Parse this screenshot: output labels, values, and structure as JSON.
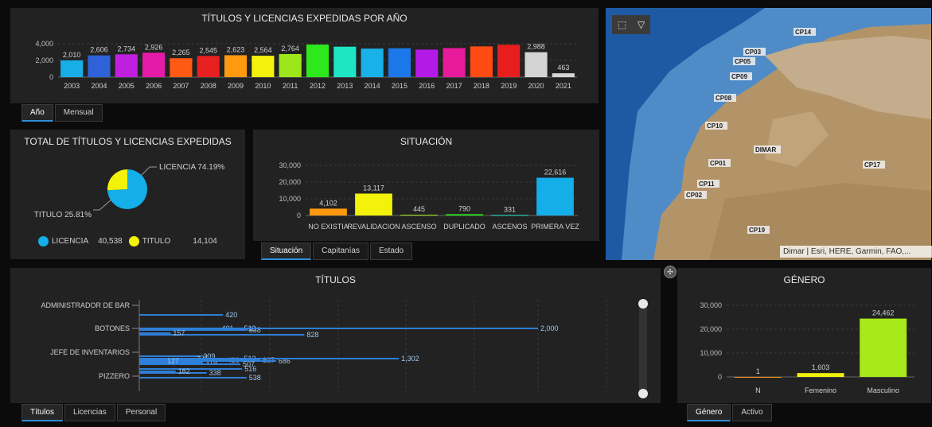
{
  "panels": {
    "years_title": "TÍTULOS Y LICENCIAS EXPEDIDAS POR AÑO",
    "total_title": "TOTAL DE TÍTULOS Y LICENCIAS EXPEDIDAS",
    "situacion_title": "SITUACIÓN",
    "titulos_title": "TÍTULOS",
    "genero_title": "GÉNERO"
  },
  "tabs": {
    "years": [
      "Año",
      "Mensual"
    ],
    "situacion": [
      "Situación",
      "Capitanías",
      "Estado"
    ],
    "titulos": [
      "Títulos",
      "Licencias",
      "Personal"
    ],
    "genero": [
      "Género",
      "Activo"
    ]
  },
  "legend": {
    "licencia_label": "LICENCIA",
    "licencia_value": "40,538",
    "licencia_color": "#14aee8",
    "titulo_label": "TITULO",
    "titulo_value": "14,104",
    "titulo_color": "#f2f20a"
  },
  "map": {
    "attribution": "Dimar | Esri, HERE, Garmin, FAO,...",
    "labels": [
      "CP14",
      "CP03",
      "CP05",
      "CP09",
      "CP08",
      "CP10",
      "DIMAR",
      "CP01",
      "CP17",
      "CP11",
      "CP02",
      "CP19"
    ]
  },
  "chart_data": [
    {
      "type": "bar",
      "title": "TÍTULOS Y LICENCIAS EXPEDIDAS POR AÑO",
      "categories": [
        "2003",
        "2004",
        "2005",
        "2006",
        "2007",
        "2008",
        "2009",
        "2010",
        "2011",
        "2012",
        "2013",
        "2014",
        "2015",
        "2016",
        "2017",
        "2018",
        "2019",
        "2020",
        "2021"
      ],
      "values": [
        2010,
        2606,
        2734,
        2926,
        2265,
        2545,
        2623,
        2564,
        2764,
        3900,
        3650,
        3420,
        3460,
        3300,
        3480,
        3680,
        3880,
        2988,
        463
      ],
      "data_labels": [
        "2,010",
        "2,606",
        "2,734",
        "2,926",
        "2,265",
        "2,545",
        "2,623",
        "2,564",
        "2,764",
        "",
        "",
        "",
        "",
        "",
        "",
        "",
        "",
        "2,988",
        "463"
      ],
      "colors": [
        "#17aee6",
        "#2f62d9",
        "#c01fe0",
        "#e61aa8",
        "#ff5a14",
        "#e8201f",
        "#ff9a10",
        "#f2f20c",
        "#9ce61a",
        "#2de81a",
        "#1ce6c4",
        "#18b2e8",
        "#1a78e8",
        "#b41ae6",
        "#e81a9c",
        "#ff4a14",
        "#e81e1e",
        "#d4d4d4",
        "#d4d4d4"
      ],
      "ylim": [
        0,
        4000
      ],
      "yticks": [
        "0",
        "2,000",
        "4,000"
      ]
    },
    {
      "type": "pie",
      "title": "TOTAL DE TÍTULOS Y LICENCIAS EXPEDIDAS",
      "labels": [
        "LICENCIA",
        "TITULO"
      ],
      "values": [
        40538,
        14104
      ],
      "percent_labels": [
        "LICENCIA 74.19%",
        "TITULO 25.81%"
      ],
      "colors": [
        "#14aee8",
        "#f2f20a"
      ]
    },
    {
      "type": "bar",
      "title": "SITUACIÓN",
      "categories": [
        "NO EXISTIA",
        "REVALIDACION",
        "ASCENSO",
        "DUPLICADO",
        "ASCENOS",
        "PRIMERA VEZ"
      ],
      "values": [
        4102,
        13117,
        445,
        790,
        331,
        22616
      ],
      "data_labels": [
        "4,102",
        "13,117",
        "445",
        "790",
        "331",
        "22,616"
      ],
      "colors": [
        "#ff9a10",
        "#f2f20a",
        "#a6e81a",
        "#2de81a",
        "#1ce6c4",
        "#14aee8"
      ],
      "ylim": [
        0,
        30000
      ],
      "yticks": [
        "0",
        "10,000",
        "20,000",
        "30,000"
      ]
    },
    {
      "type": "bar",
      "title": "TÍTULOS",
      "orientation": "horizontal",
      "categories": [
        "ADMINISTRADOR DE BAR",
        "BOTONES",
        "JEFE DE INVENTARIOS",
        "PIZZERO"
      ],
      "visible_values": [
        420,
        401,
        513,
        538,
        828,
        157,
        2000,
        309,
        275,
        319,
        430,
        513,
        607,
        686,
        507,
        516,
        1302,
        127,
        338,
        182,
        538
      ],
      "color": "#2e7fd9"
    },
    {
      "type": "bar",
      "title": "GÉNERO",
      "categories": [
        "N",
        "Femenino",
        "Masculino"
      ],
      "values": [
        1,
        1603,
        24462
      ],
      "data_labels": [
        "1",
        "1,603",
        "24,462"
      ],
      "colors": [
        "#ff9a10",
        "#f2f20a",
        "#a6e81a"
      ],
      "ylim": [
        0,
        30000
      ],
      "yticks": [
        "0",
        "10,000",
        "20,000",
        "30,000"
      ]
    }
  ]
}
